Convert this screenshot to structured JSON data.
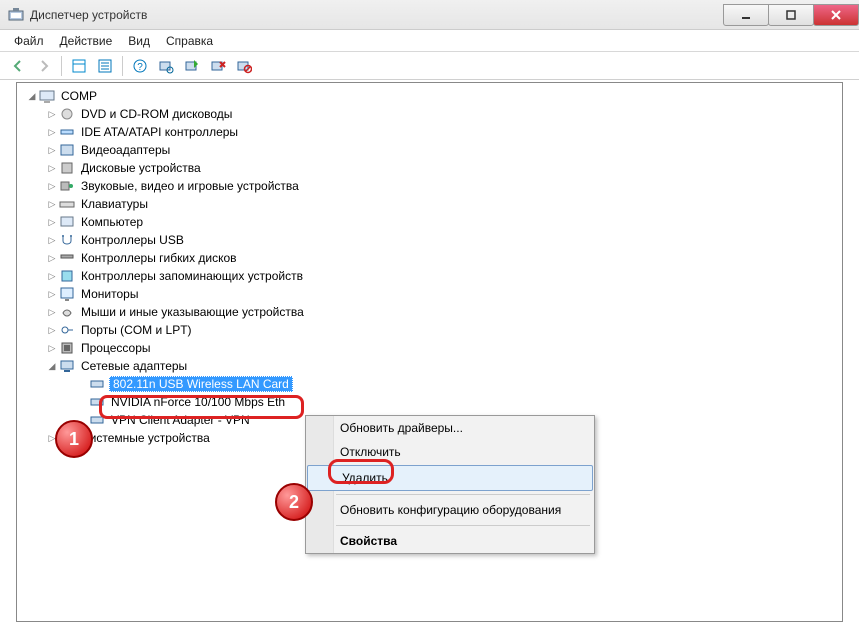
{
  "window": {
    "title": "Диспетчер устройств"
  },
  "menu": {
    "file": "Файл",
    "action": "Действие",
    "view": "Вид",
    "help": "Справка"
  },
  "tree": {
    "root": "COMP",
    "items": [
      "DVD и CD-ROM дисководы",
      "IDE ATA/ATAPI контроллеры",
      "Видеоадаптеры",
      "Дисковые устройства",
      "Звуковые, видео и игровые устройства",
      "Клавиатуры",
      "Компьютер",
      "Контроллеры USB",
      "Контроллеры гибких дисков",
      "Контроллеры запоминающих устройств",
      "Мониторы",
      "Мыши и иные указывающие устройства",
      "Порты (COM и LPT)",
      "Процессоры"
    ],
    "net_adapters": "Сетевые адаптеры",
    "adapter1": "802.11n USB Wireless LAN Card",
    "adapter2": "NVIDIA nForce 10/100 Mbps Eth",
    "adapter3": "VPN Client Adapter - VPN",
    "system_devices": "Системные устройства"
  },
  "context": {
    "update": "Обновить драйверы...",
    "disable": "Отключить",
    "remove": "Удалить",
    "rescan": "Обновить конфигурацию оборудования",
    "properties": "Свойства"
  },
  "badges": {
    "one": "1",
    "two": "2"
  }
}
